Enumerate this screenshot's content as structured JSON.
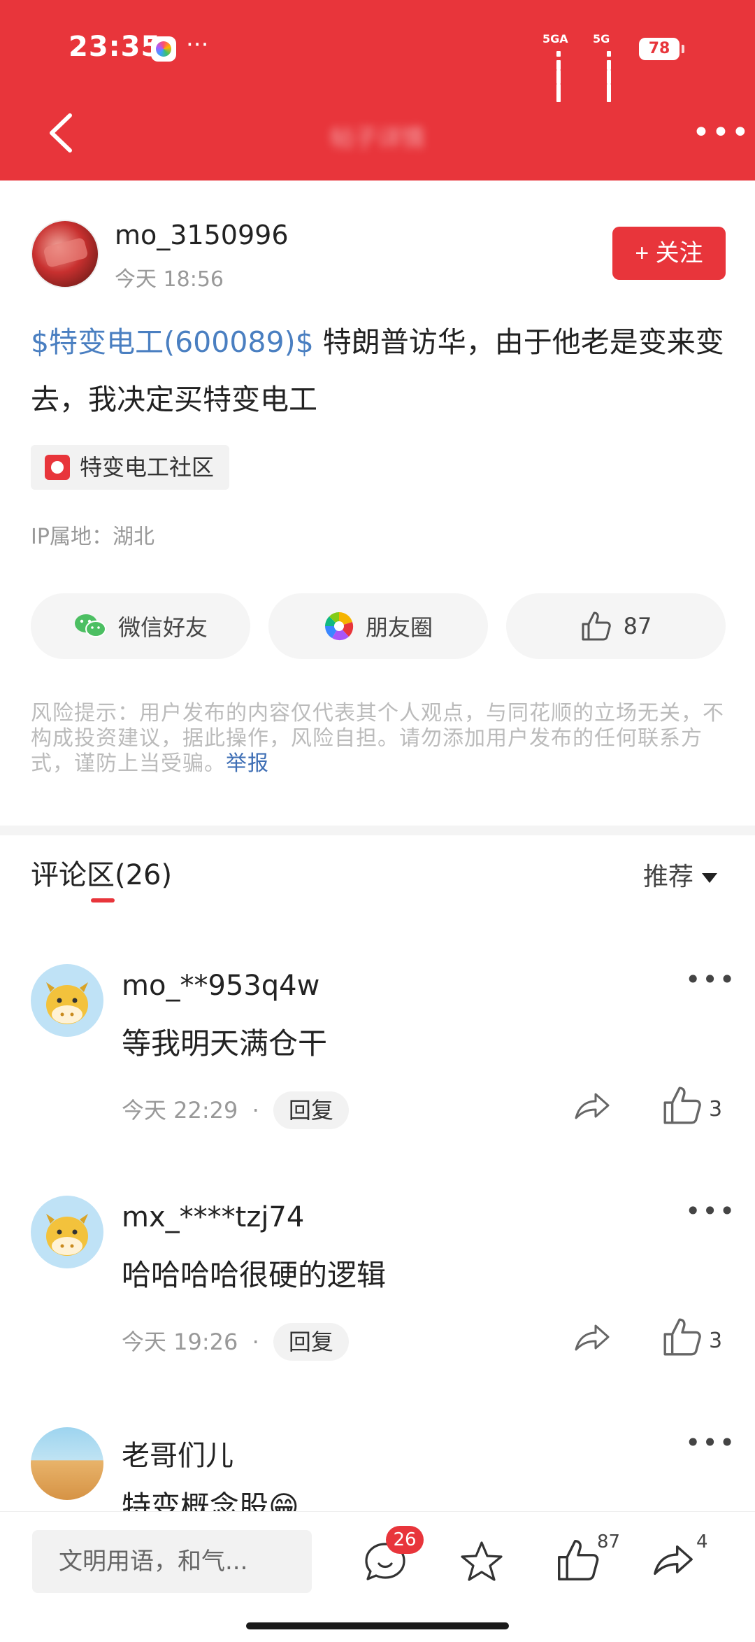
{
  "status_bar": {
    "time": "23:35",
    "signal1": "5GA",
    "signal2": "5G",
    "battery": "78"
  },
  "nav": {
    "title": "帖子详情"
  },
  "post": {
    "author": "mo_3150996",
    "time": "今天 18:56",
    "follow_label": "+ 关注",
    "stock_tag": "$特变电工(600089)$",
    "body": " 特朗普访华，由于他老是变来变去，我决定买特变电工",
    "community": "特变电工社区",
    "ip": "IP属地：湖北",
    "share_wechat": "微信好友",
    "share_moments": "朋友圈",
    "like_count": "87",
    "risk_text": "风险提示：用户发布的内容仅代表其个人观点，与同花顺的立场无关，不构成投资建议，据此操作，风险自担。请勿添加用户发布的任何联系方式，谨防上当受骗。",
    "report_label": "举报"
  },
  "comments_section": {
    "title": "评论区(26)",
    "sort_label": "推荐"
  },
  "comments": [
    {
      "name": "mo_**953q4w",
      "text": "等我明天满仓干",
      "time": "今天 22:29",
      "reply": "回复",
      "likes": "3"
    },
    {
      "name": "mx_****tzj74",
      "text": "哈哈哈哈很硬的逻辑",
      "time": "今天 19:26",
      "reply": "回复",
      "likes": "3"
    },
    {
      "name": "老哥们儿",
      "text": "特变概念股😁",
      "time": "",
      "reply": "",
      "likes": ""
    }
  ],
  "bottom_bar": {
    "input_placeholder": "文明用语，和气...",
    "comment_badge": "26",
    "like_count": "87",
    "share_count": "4"
  },
  "colors": {
    "brand_red": "#e8353b",
    "link_blue": "#4a7fc1"
  }
}
